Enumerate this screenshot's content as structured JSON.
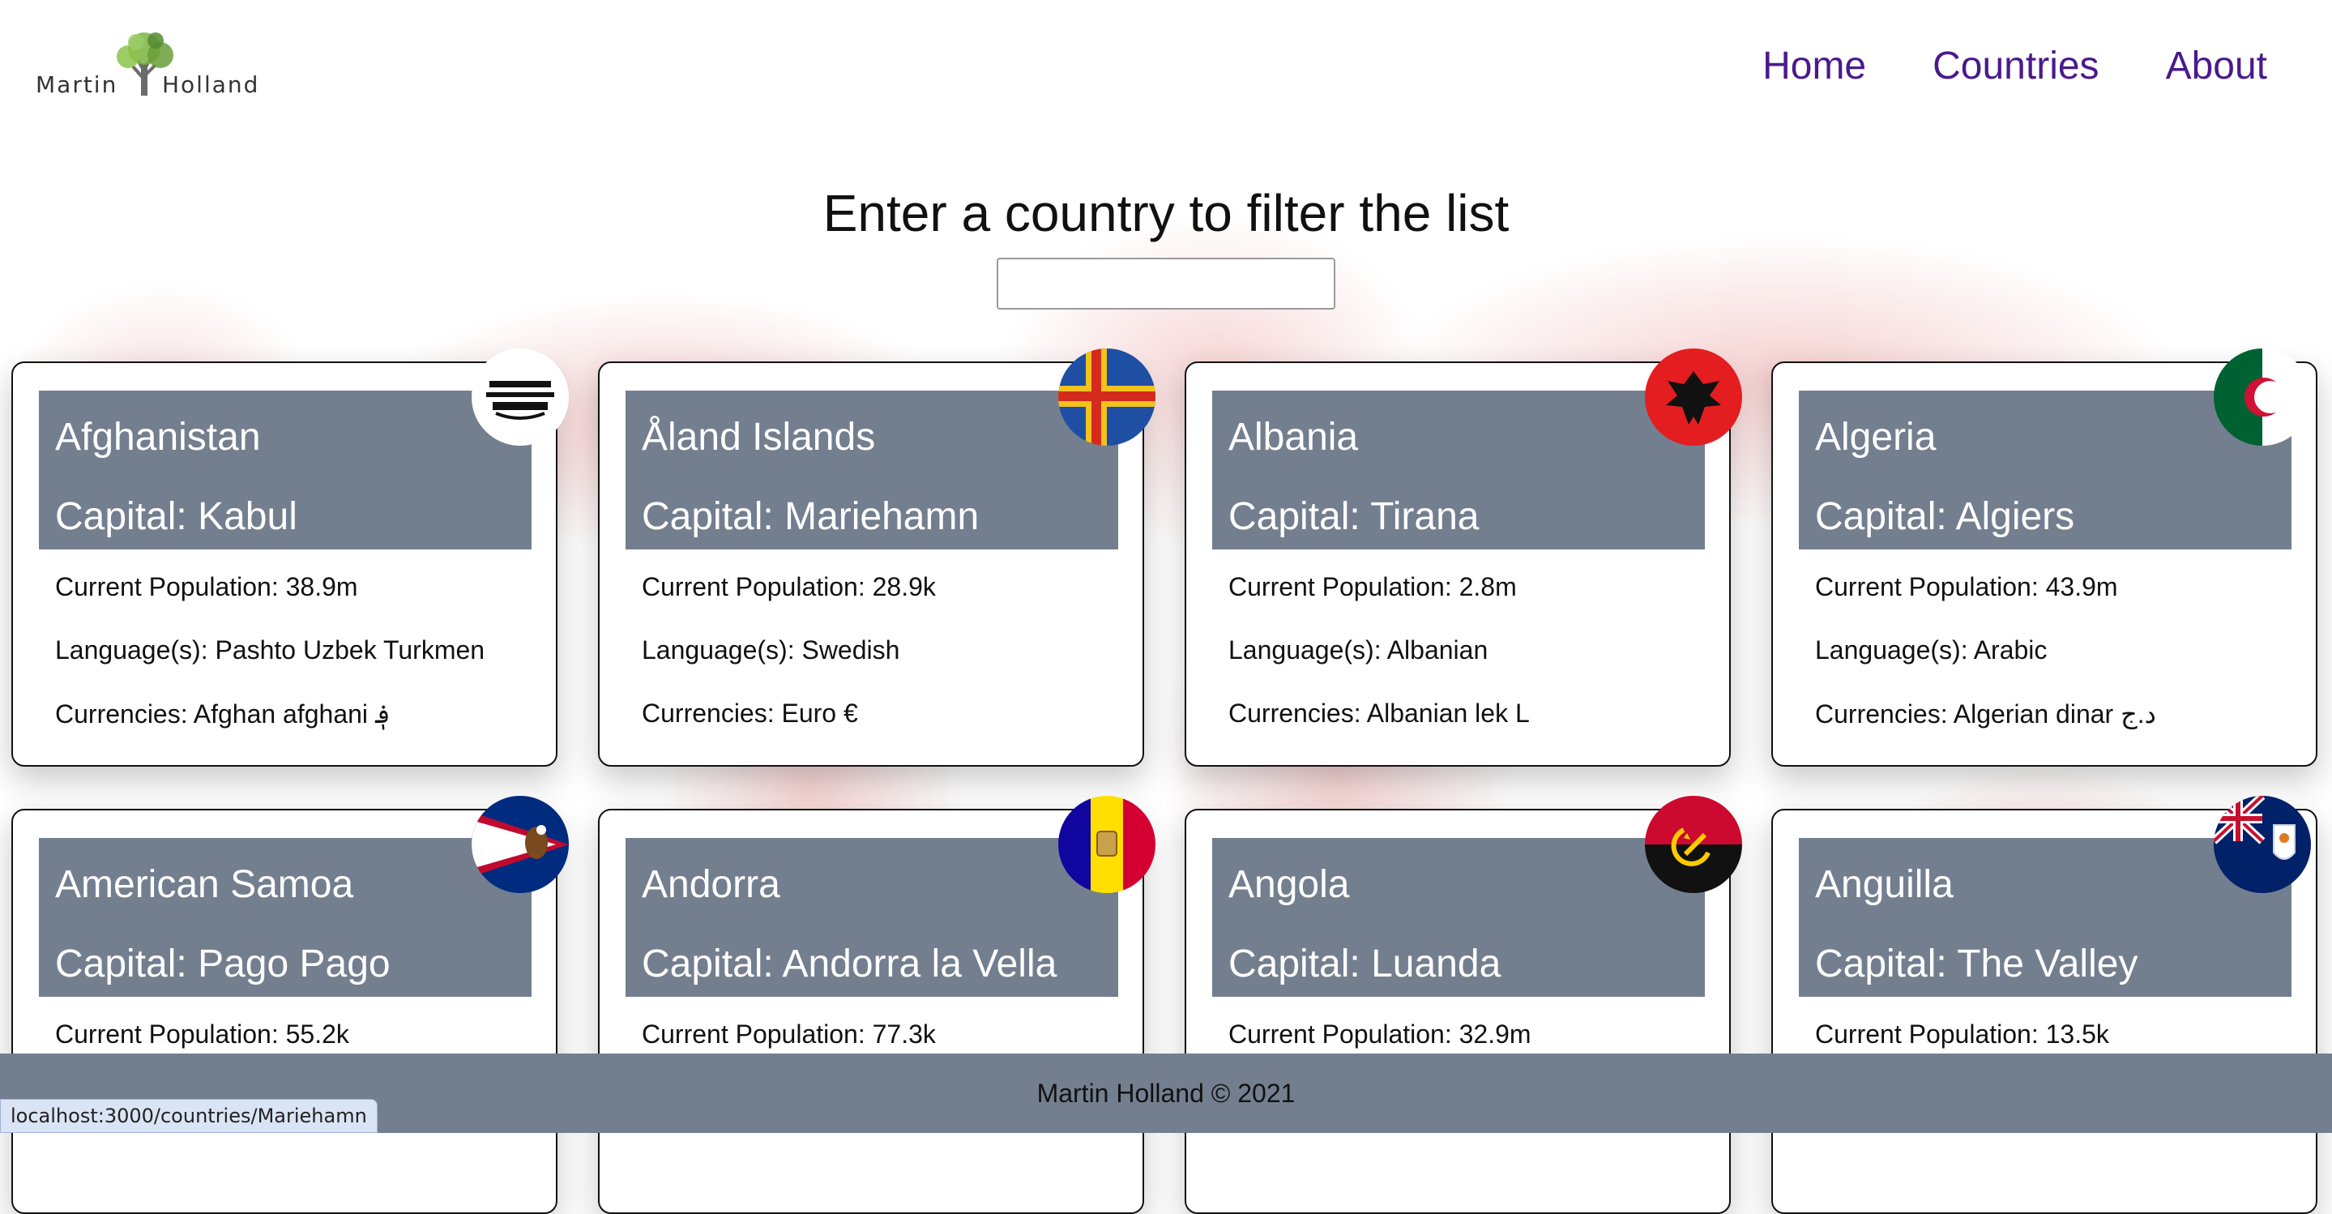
{
  "brand": {
    "first": "Martin",
    "last": "Holland"
  },
  "nav": {
    "home": "Home",
    "countries": "Countries",
    "about": "About"
  },
  "filter": {
    "heading": "Enter a country to filter the list",
    "value": ""
  },
  "colors": {
    "nav_link": "#4a1a8c",
    "card_header": "#737f8f",
    "footer": "#737f8f"
  },
  "countries": [
    {
      "name": "Afghanistan",
      "capital": "Capital: Kabul",
      "population": "Current Population: 38.9m",
      "languages": "Language(s): Pashto Uzbek Turkmen",
      "currencies": "Currencies: Afghan afghani ؋",
      "flag": "afghanistan-flag"
    },
    {
      "name": "Åland Islands",
      "capital": "Capital: Mariehamn",
      "population": "Current Population: 28.9k",
      "languages": "Language(s): Swedish",
      "currencies": "Currencies: Euro €",
      "flag": "aland-flag"
    },
    {
      "name": "Albania",
      "capital": "Capital: Tirana",
      "population": "Current Population: 2.8m",
      "languages": "Language(s): Albanian",
      "currencies": "Currencies: Albanian lek L",
      "flag": "albania-flag"
    },
    {
      "name": "Algeria",
      "capital": "Capital: Algiers",
      "population": "Current Population: 43.9m",
      "languages": "Language(s): Arabic",
      "currencies": "Currencies: Algerian dinar د.ج",
      "flag": "algeria-flag"
    },
    {
      "name": "American Samoa",
      "capital": "Capital: Pago Pago",
      "population": "Current Population: 55.2k",
      "languages": "",
      "currencies": "",
      "flag": "american-samoa-flag"
    },
    {
      "name": "Andorra",
      "capital": "Capital: Andorra la Vella",
      "population": "Current Population: 77.3k",
      "languages": "",
      "currencies": "",
      "flag": "andorra-flag"
    },
    {
      "name": "Angola",
      "capital": "Capital: Luanda",
      "population": "Current Population: 32.9m",
      "languages": "",
      "currencies": "",
      "flag": "angola-flag"
    },
    {
      "name": "Anguilla",
      "capital": "Capital: The Valley",
      "population": "Current Population: 13.5k",
      "languages": "",
      "currencies": "",
      "flag": "anguilla-flag"
    }
  ],
  "footer": {
    "text": "Martin Holland © 2021"
  },
  "status_bar": {
    "url": "localhost:3000/countries/Mariehamn"
  }
}
